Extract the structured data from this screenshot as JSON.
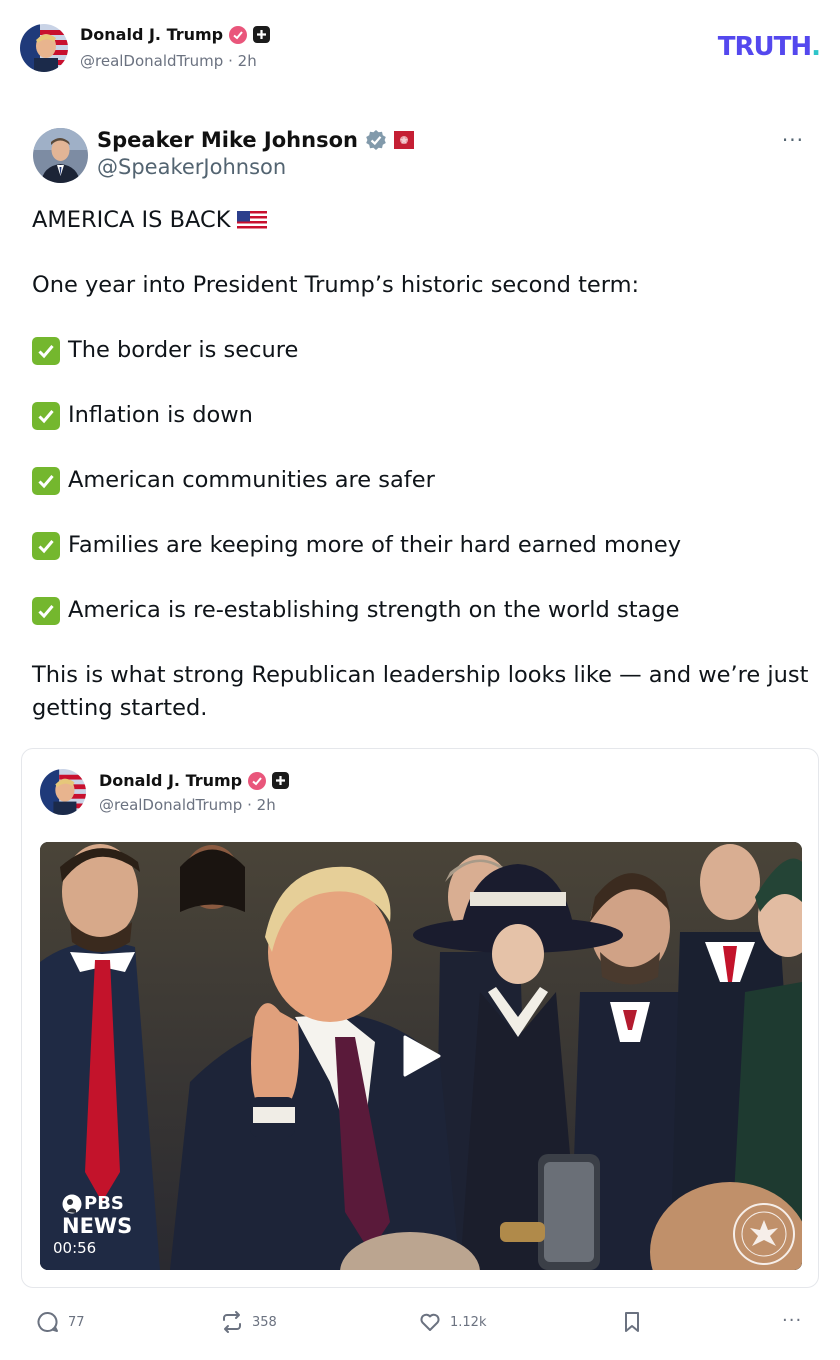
{
  "header": {
    "author_name": "Donald J. Trump",
    "author_handle": "@realDonaldTrump",
    "time_sep": "·",
    "time": "2h",
    "logo_main": "TRUTH",
    "logo_dot": ".",
    "avatar_icon": "flag-portrait-avatar",
    "verified_icon": "verified-badge-icon",
    "plus_icon": "plus-badge-icon"
  },
  "embedded_post": {
    "author_name": "Speaker Mike Johnson",
    "author_handle": "@SpeakerJohnson",
    "more_label": "···",
    "verified_icon": "verified-gray-icon",
    "affiliate_icon": "house-flag-icon",
    "headline": "AMERICA IS BACK",
    "flag_icon": "us-flag-emoji",
    "intro": "One year into President Trump’s historic second term:",
    "checklist": [
      "The border is secure",
      "Inflation is down",
      "American communities are safer",
      "Families are keeping more of their hard earned money",
      "America is re-establishing strength on the world stage"
    ],
    "closing": "This is what strong Republican leadership looks like — and we’re just getting started."
  },
  "quoted": {
    "author_name": "Donald J. Trump",
    "author_handle": "@realDonaldTrump",
    "time_sep": "·",
    "time": "2h",
    "video": {
      "duration": "00:56",
      "network_line1": "PBS",
      "network_line2": "NEWS",
      "play_icon": "play-icon",
      "seal_icon": "house-seal-icon"
    }
  },
  "actions": {
    "replies": "77",
    "retruths": "358",
    "likes": "1.12k",
    "more_label": "···"
  },
  "colors": {
    "truth_purple": "#5448ee",
    "truth_teal": "#2ec5c9",
    "verified_pink": "#e9567b",
    "check_green": "#74b72e",
    "muted": "#6b7280"
  }
}
